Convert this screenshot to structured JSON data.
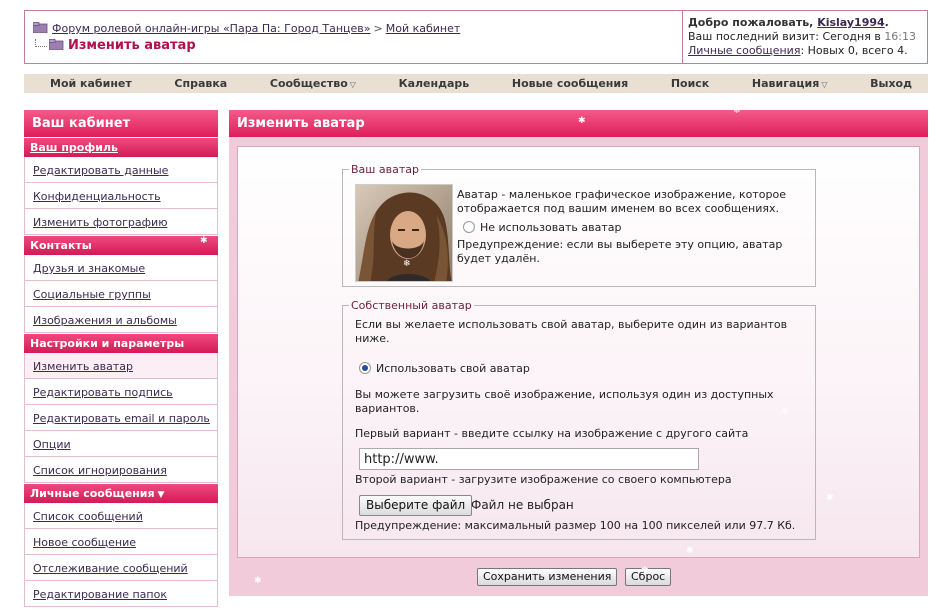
{
  "header": {
    "forum_link": "Форум ролевой онлайн-игры «Пара Па: Город Танцев»",
    "separator": ">",
    "cabinet_link": "Мой кабинет",
    "current_page": "Изменить аватар",
    "welcome_prefix": "Добро пожаловать,",
    "username": "Kislay1994",
    "welcome_suffix": ".",
    "last_visit_label": "Ваш последний визит: Сегодня в",
    "last_visit_time": "16:13",
    "pm_link": "Личные сообщения",
    "pm_status": ": Новых 0, всего 4."
  },
  "navbar": {
    "items": [
      {
        "label": "Мой кабинет"
      },
      {
        "label": "Справка"
      },
      {
        "label": "Сообщество",
        "dropdown": true
      },
      {
        "label": "Календарь"
      },
      {
        "label": "Новые сообщения"
      },
      {
        "label": "Поиск"
      },
      {
        "label": "Навигация",
        "dropdown": true
      },
      {
        "label": "Выход"
      }
    ]
  },
  "sidebar": {
    "title": "Ваш кабинет",
    "profile_section": "Ваш профиль",
    "profile_items": [
      "Редактировать данные",
      "Конфиденциальность",
      "Изменить фотографию"
    ],
    "contacts_section": "Контакты",
    "contacts_items": [
      "Друзья и знакомые",
      "Социальные группы",
      "Изображения и альбомы"
    ],
    "settings_section": "Настройки и параметры",
    "settings_items": [
      "Изменить аватар",
      "Редактировать подпись",
      "Редактировать email и пароль",
      "Опции",
      "Список игнорирования"
    ],
    "pm_section": "Личные сообщения",
    "pm_items": [
      "Список сообщений",
      "Новое сообщение",
      "Отслеживание сообщений",
      "Редактирование папок"
    ]
  },
  "main": {
    "title": "Изменить аватар",
    "current_avatar": {
      "legend": "Ваш аватар",
      "description": "Аватар - маленькое графическое изображение, которое отображается под вашим именем во всех сообщениях.",
      "no_avatar_option": "Не использовать аватар",
      "warning": "Предупреждение: если вы выберете эту опцию, аватар будет удалён."
    },
    "custom_avatar": {
      "legend": "Собственный аватар",
      "intro": "Если вы желаете использовать свой аватар, выберите один из вариантов ниже.",
      "use_custom_option": "Использовать свой аватар",
      "upload_intro": "Вы можете загрузить своё изображение, используя один из доступных вариантов.",
      "option1_label": "Первый вариант - введите ссылку на изображение с другого сайта",
      "url_value": "http://www.",
      "option2_label": "Второй вариант - загрузите изображение со своего компьютера",
      "choose_file_button": "Выберите файл",
      "no_file_text": "Файл не выбран",
      "size_warning": "Предупреждение: максимальный размер 100 на 100 пикселей или 97.7 Кб."
    },
    "save_button": "Сохранить изменения",
    "reset_button": "Сброс"
  },
  "colors": {
    "accent_pink": "#dd1e5c",
    "current_page_text": "#b0114f",
    "panel_background": "#f2cbda",
    "navbar_background": "#e9e0d3"
  }
}
